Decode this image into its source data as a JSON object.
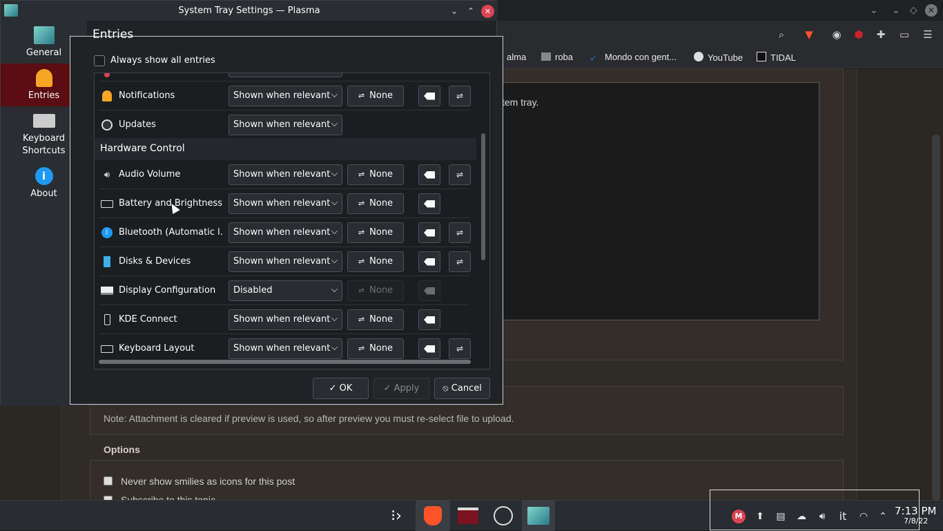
{
  "window": {
    "title": "System Tray Settings — Plasma"
  },
  "sidebar": {
    "items": [
      {
        "label": "General",
        "icon": "kde-general-icon"
      },
      {
        "label": "Entries",
        "icon": "bell-icon",
        "active": true
      },
      {
        "label": "Keyboard\nShortcuts",
        "icon": "keyboard-icon"
      },
      {
        "label": "About",
        "icon": "info-icon"
      }
    ]
  },
  "dialog": {
    "heading": "Entries",
    "always_show_label": "Always show all entries",
    "section_hardware": "Hardware Control",
    "rows_top": [
      {
        "name": "Notifications",
        "visibility": "Shown when relevant",
        "shortcut": "None",
        "has_config": true,
        "icon": "bell-icon"
      },
      {
        "name": "Updates",
        "visibility": "Shown when relevant",
        "icon": "updates-icon"
      }
    ],
    "rows_hardware": [
      {
        "name": "Audio Volume",
        "visibility": "Shown when relevant",
        "shortcut": "None",
        "has_config": true,
        "icon": "speaker-icon"
      },
      {
        "name": "Battery and Brightness ...",
        "visibility": "Shown when relevant",
        "shortcut": "None",
        "has_config": false,
        "icon": "battery-icon"
      },
      {
        "name": "Bluetooth (Automatic l...",
        "visibility": "Shown when relevant",
        "shortcut": "None",
        "has_config": true,
        "icon": "bluetooth-icon"
      },
      {
        "name": "Disks & Devices",
        "visibility": "Shown when relevant",
        "shortcut": "None",
        "has_config": true,
        "icon": "usb-icon"
      },
      {
        "name": "Display Configuration",
        "visibility": "Disabled",
        "shortcut": "None",
        "has_config": false,
        "disabled": true,
        "icon": "display-icon"
      },
      {
        "name": "KDE Connect",
        "visibility": "Shown when relevant",
        "shortcut": "None",
        "has_config": false,
        "icon": "phone-icon"
      },
      {
        "name": "Keyboard Layout",
        "visibility": "Shown when relevant",
        "shortcut": "None",
        "has_config": true,
        "icon": "keyboard-icon"
      }
    ],
    "ok_label": "OK",
    "apply_label": "Apply",
    "cancel_label": "Cancel"
  },
  "browser": {
    "bookmarks": [
      "alma",
      "roba",
      "Mondo con gent...",
      "YouTube",
      "TIDAL"
    ],
    "textarea_text": "stem tray.",
    "note": "Note: Attachment is cleared if preview is used, so after preview you must re-select file to upload.",
    "options_title": "Options",
    "opt1": "Never show smilies as icons for this post",
    "opt2": "Subscribe to this topic"
  },
  "taskbar": {
    "apps": [
      "kickoff-icon",
      "brave-icon",
      "files-icon",
      "clock-app-icon",
      "settings-app-icon"
    ],
    "keyboard_layout": "it",
    "time": "7:13 PM",
    "date": "7/8/22"
  }
}
